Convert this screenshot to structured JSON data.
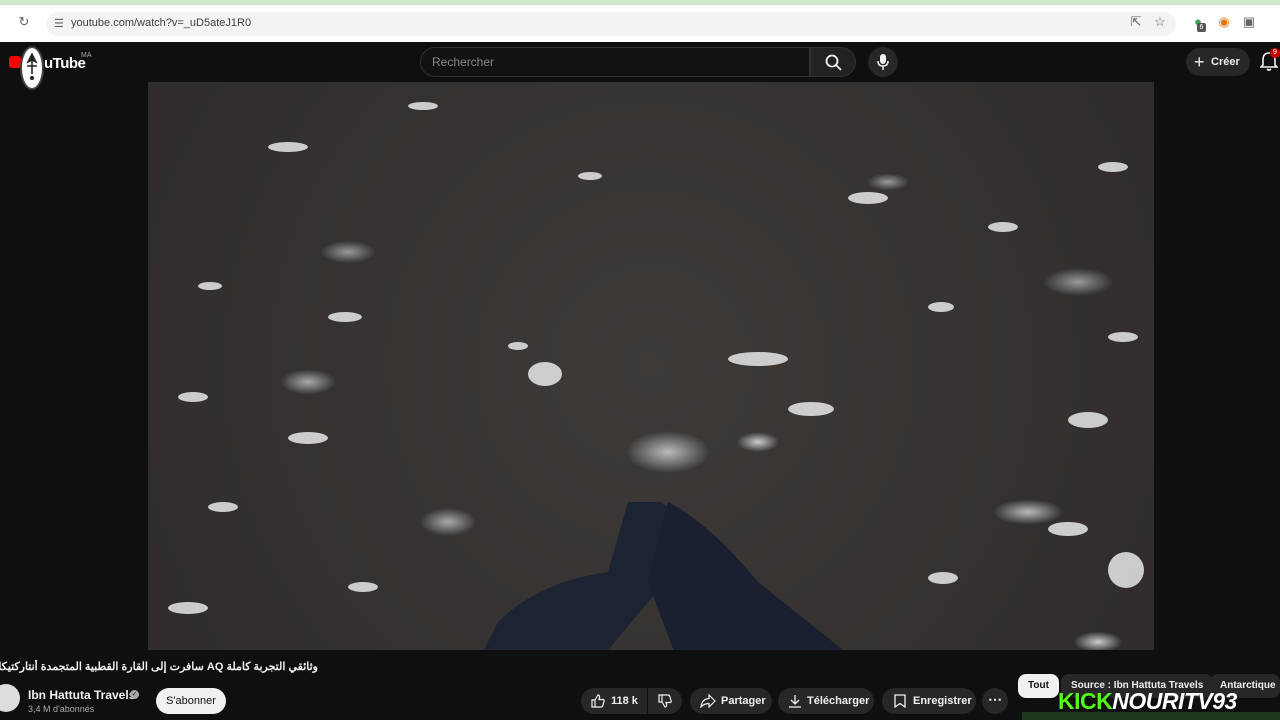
{
  "browser": {
    "url": "youtube.com/watch?v=_uD5ateJ1R0",
    "extension_badge": "6"
  },
  "header": {
    "logo_text": "uTube",
    "country_code": "MA",
    "search_placeholder": "Rechercher",
    "create_label": "Créer",
    "notification_count": "9"
  },
  "video": {
    "title": "وثائقي التجربة كاملة AQ سافرت إلى القارة القطبية المتجمدة أنتاركتيكا",
    "channel_name": "Ibn Hattuta Travels",
    "subscribers": "3,4 M d'abonnés",
    "subscribe_label": "S'abonner",
    "likes": "118 k",
    "share_label": "Partager",
    "download_label": "Télécharger",
    "save_label": "Enregistrer"
  },
  "chips": [
    "Tout",
    "Source : Ibn Hattuta Travels",
    "Antarctique"
  ],
  "overlay": {
    "watermark_kick": "KICK",
    "watermark_name": "NOURITV93"
  },
  "colors": {
    "background": "#0f0f0f",
    "brand_red": "#ff0000",
    "kick_green": "#53fc18"
  },
  "icons": [
    "reload-icon",
    "install-icon",
    "star-icon",
    "extension-icon",
    "puzzle-icon",
    "search-icon",
    "mic-icon",
    "plus-icon",
    "bell-icon",
    "like-icon",
    "dislike-icon",
    "share-icon",
    "download-icon",
    "bookmark-icon",
    "more-icon",
    "verified-icon"
  ]
}
